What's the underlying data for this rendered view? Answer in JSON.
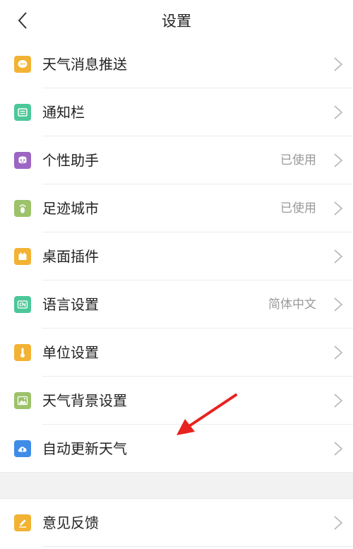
{
  "header": {
    "title": "设置",
    "back_icon": "chevron-left-icon"
  },
  "settings": [
    {
      "label": "天气消息推送",
      "status": "",
      "icon": "message-bubble-icon",
      "icon_color": "#F2B233"
    },
    {
      "label": "通知栏",
      "status": "",
      "icon": "notification-bar-icon",
      "icon_color": "#4CC79A"
    },
    {
      "label": "个性助手",
      "status": "已使用",
      "icon": "assistant-face-icon",
      "icon_color": "#9C66C2"
    },
    {
      "label": "足迹城市",
      "status": "已使用",
      "icon": "footprint-icon",
      "icon_color": "#9CC26A"
    },
    {
      "label": "桌面插件",
      "status": "",
      "icon": "widget-icon",
      "icon_color": "#F2B233"
    },
    {
      "label": "语言设置",
      "status": "简体中文",
      "icon": "language-cn-icon",
      "icon_color": "#4CC79A"
    },
    {
      "label": "单位设置",
      "status": "",
      "icon": "thermometer-icon",
      "icon_color": "#F2B233"
    },
    {
      "label": "天气背景设置",
      "status": "",
      "icon": "image-landscape-icon",
      "icon_color": "#9CC26A"
    },
    {
      "label": "自动更新天气",
      "status": "",
      "icon": "cloud-upload-icon",
      "icon_color": "#3F8CE8"
    }
  ],
  "feedback": {
    "label": "意见反馈",
    "status": "",
    "icon": "pencil-icon",
    "icon_color": "#F2B233"
  },
  "annotation": {
    "color": "#E8221E"
  }
}
